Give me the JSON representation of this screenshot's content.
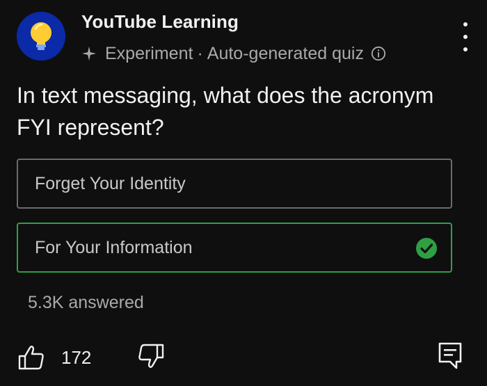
{
  "header": {
    "channel_name": "YouTube Learning",
    "badge_label": "Experiment",
    "separator": "·",
    "source_label": "Auto-generated quiz",
    "avatar_icon": "lightbulb-icon",
    "badge_icon": "sparkle-icon",
    "info_icon": "info-icon",
    "more_icon": "more-vert-icon"
  },
  "quiz": {
    "question": "In text messaging, what does the acronym FYI represent?",
    "options": [
      {
        "label": "Forget Your Identity",
        "state": "unselected"
      },
      {
        "label": "For Your Information",
        "state": "correct"
      }
    ],
    "answered_count": "5.3K answered"
  },
  "actions": {
    "like_count": "172",
    "like_icon": "thumb-up-icon",
    "dislike_icon": "thumb-down-icon",
    "comment_icon": "comment-icon"
  },
  "colors": {
    "background": "#0f0f0f",
    "avatar_background": "#0a2aa8",
    "bulb_yellow": "#ffcc33",
    "correct_green": "#2ea043",
    "option_border": "#6b6b6b",
    "secondary_text": "#aaaaaa"
  }
}
